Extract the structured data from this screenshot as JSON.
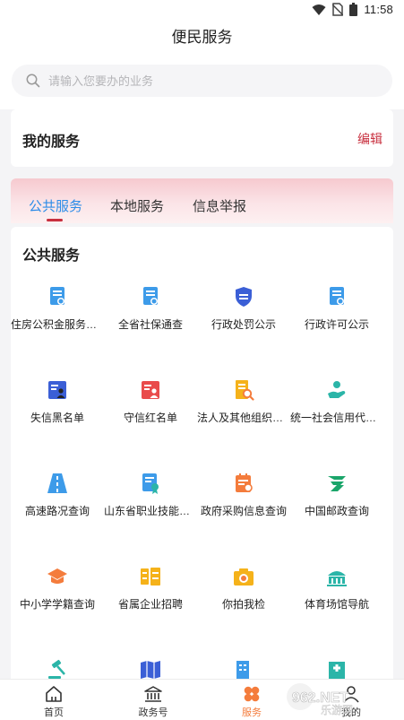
{
  "status_bar": {
    "time": "11:58"
  },
  "header": {
    "title": "便民服务"
  },
  "search": {
    "placeholder": "请输入您要办的业务"
  },
  "my_services": {
    "title": "我的服务",
    "edit_label": "编辑"
  },
  "tabs": [
    {
      "label": "公共服务",
      "active": true
    },
    {
      "label": "本地服务",
      "active": false
    },
    {
      "label": "信息举报",
      "active": false
    }
  ],
  "section": {
    "title": "公共服务"
  },
  "services": [
    {
      "label": "住房公积金服务大厅",
      "icon": "document-badge-icon",
      "color": "#3d9be9"
    },
    {
      "label": "全省社保通查",
      "icon": "document-badge-icon",
      "color": "#3d9be9"
    },
    {
      "label": "行政处罚公示",
      "icon": "shield-penalty-icon",
      "color": "#3b5fd6"
    },
    {
      "label": "行政许可公示",
      "icon": "document-badge-icon",
      "color": "#3d9be9"
    },
    {
      "label": "失信黑名单",
      "icon": "person-list-icon",
      "color": "#3b5fd6"
    },
    {
      "label": "守信红名单",
      "icon": "person-list-icon",
      "color": "#e94b4b"
    },
    {
      "label": "法人及其他组织信...",
      "icon": "book-search-icon",
      "color": "#f5b21a"
    },
    {
      "label": "统一社会信用代码...",
      "icon": "hand-person-icon",
      "color": "#2bb5a8"
    },
    {
      "label": "高速路况查询",
      "icon": "highway-icon",
      "color": "#3d9be9"
    },
    {
      "label": "山东省职业技能证...",
      "icon": "certificate-icon",
      "color": "#3d9be9"
    },
    {
      "label": "政府采购信息查询",
      "icon": "procurement-icon",
      "color": "#f47c3c"
    },
    {
      "label": "中国邮政查询",
      "icon": "china-post-icon",
      "color": "#1aa56a"
    },
    {
      "label": "中小学学籍查询",
      "icon": "graduation-cap-icon",
      "color": "#f47c3c"
    },
    {
      "label": "省属企业招聘",
      "icon": "recruit-icon",
      "color": "#f5b21a"
    },
    {
      "label": "你拍我检",
      "icon": "camera-icon",
      "color": "#f5b21a"
    },
    {
      "label": "体育场馆导航",
      "icon": "stadium-icon",
      "color": "#2bb5a8"
    },
    {
      "label": "",
      "icon": "gavel-icon",
      "color": "#2bb5a8"
    },
    {
      "label": "",
      "icon": "map-icon",
      "color": "#3b5fd6"
    },
    {
      "label": "",
      "icon": "building-icon",
      "color": "#3d9be9"
    },
    {
      "label": "",
      "icon": "hospital-icon",
      "color": "#2bb5a8"
    }
  ],
  "bottom_nav": [
    {
      "label": "首页",
      "icon": "home-icon",
      "active": false
    },
    {
      "label": "政务号",
      "icon": "government-building-icon",
      "active": false
    },
    {
      "label": "服务",
      "icon": "service-clover-icon",
      "active": true
    },
    {
      "label": "我的",
      "icon": "user-icon",
      "active": false
    }
  ],
  "watermark": {
    "text": "962.NET",
    "subtext": "乐游网"
  },
  "colors": {
    "accent_red": "#c8303f",
    "tab_active_blue": "#2c8ce8",
    "nav_active_orange": "#f47c3c"
  }
}
